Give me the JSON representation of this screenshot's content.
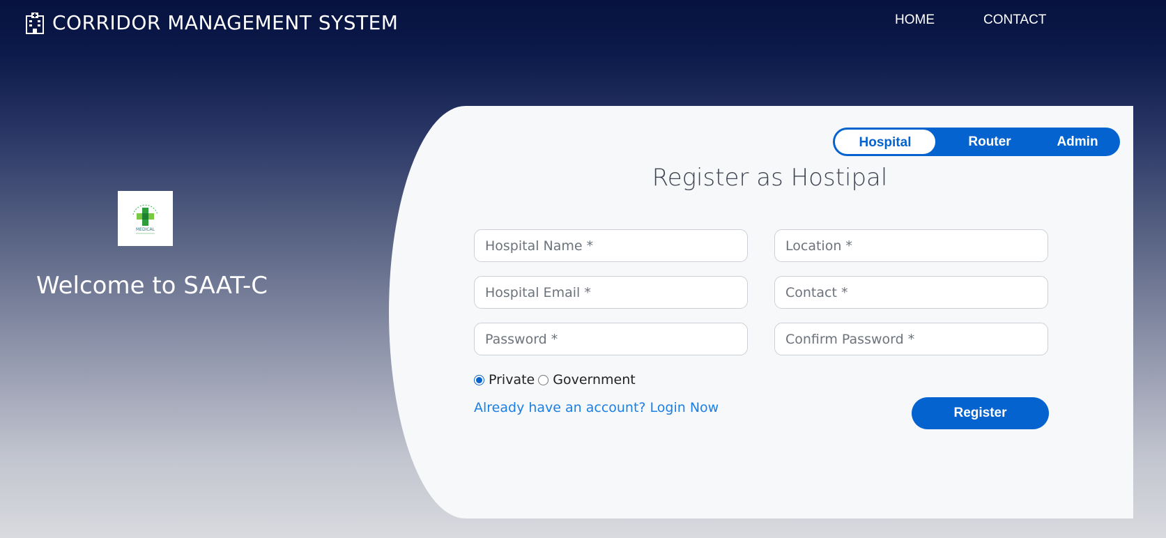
{
  "header": {
    "title": "CORRIDOR MANAGEMENT SYSTEM",
    "icon": "hospital-icon",
    "nav": [
      {
        "label": "HOME"
      },
      {
        "label": "CONTACT"
      }
    ]
  },
  "left": {
    "logo_text": "MEDICAL",
    "welcome": "Welcome to SAAT-C"
  },
  "switcher": {
    "tabs": [
      {
        "label": "Hospital",
        "active": true
      },
      {
        "label": "Router",
        "active": false
      },
      {
        "label": "Admin",
        "active": false
      }
    ]
  },
  "form": {
    "title": "Register as Hostipal",
    "fields": {
      "hospital_name": {
        "placeholder": "Hospital Name *",
        "value": ""
      },
      "location": {
        "placeholder": "Location *",
        "value": ""
      },
      "hospital_email": {
        "placeholder": "Hospital Email *",
        "value": ""
      },
      "contact": {
        "placeholder": "Contact *",
        "value": ""
      },
      "password": {
        "placeholder": "Password *",
        "value": ""
      },
      "confirm_password": {
        "placeholder": "Confirm Password *",
        "value": ""
      }
    },
    "type_options": [
      {
        "label": "Private",
        "selected": true
      },
      {
        "label": "Government",
        "selected": false
      }
    ],
    "login_link": "Already have an account? Login Now",
    "submit_label": "Register"
  },
  "colors": {
    "accent": "#0563cf",
    "link": "#1a7fe6",
    "header_bg": "#07123f",
    "card_bg": "#f7f8fa"
  }
}
